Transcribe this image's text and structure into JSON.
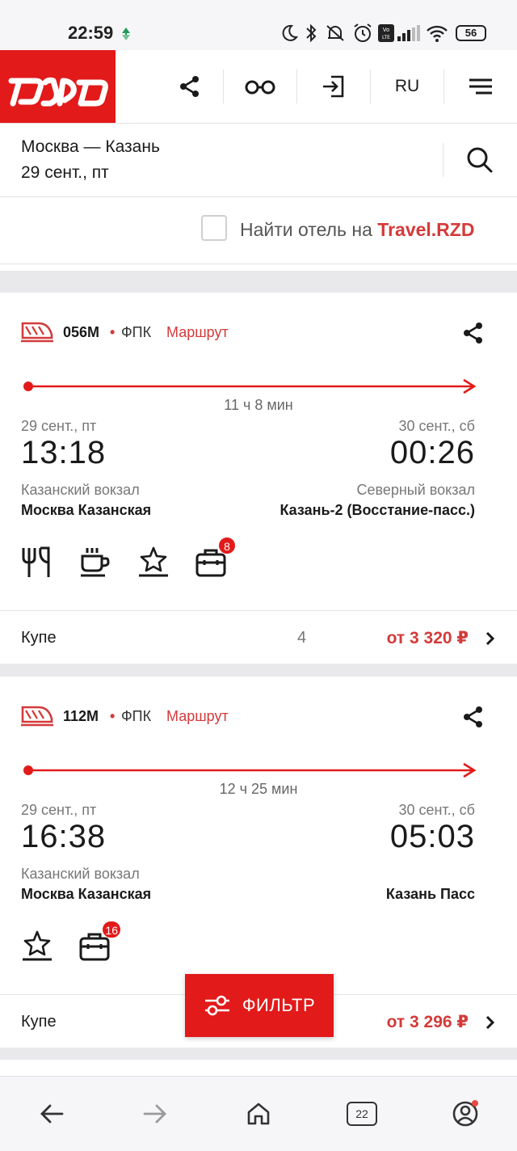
{
  "status": {
    "time": "22:59",
    "battery": "56"
  },
  "header": {
    "logo_text": "РЖД",
    "lang": "RU",
    "icons": [
      "share-icon",
      "glasses-icon",
      "login-icon",
      "menu-icon"
    ]
  },
  "search": {
    "route": "Москва — Казань",
    "date": "29 сент., пт"
  },
  "hotel": {
    "prefix": "Найти отель на ",
    "brand": "Travel.RZD"
  },
  "trains": [
    {
      "number": "056М",
      "carrier": "ФПК",
      "route_link": "Маршрут",
      "duration": "11 ч 8 мин",
      "departure": {
        "date": "29 сент., пт",
        "time": "13:18",
        "station_sub": "Казанский вокзал",
        "station": "Москва Казанская"
      },
      "arrival": {
        "date": "30 сент., сб",
        "time": "00:26",
        "station_sub": "Северный вокзал",
        "station": "Казань-2 (Восстание-пасс.)"
      },
      "amenities": [
        "restaurant-icon",
        "coffee-icon",
        "star-icon",
        "luggage-icon"
      ],
      "luggage_badge": "8",
      "fare": {
        "class": "Купе",
        "seats": "4",
        "price": "от 3 320 ₽"
      }
    },
    {
      "number": "112М",
      "carrier": "ФПК",
      "route_link": "Маршрут",
      "duration": "12 ч 25 мин",
      "departure": {
        "date": "29 сент., пт",
        "time": "16:38",
        "station_sub": "Казанский вокзал",
        "station": "Москва Казанская"
      },
      "arrival": {
        "date": "30 сент., сб",
        "time": "05:03",
        "station_sub": "",
        "station": "Казань Пасс"
      },
      "amenities": [
        "star-icon",
        "luggage-icon"
      ],
      "luggage_badge": "16",
      "fare": {
        "class": "Купе",
        "seats": "",
        "price": "от 3 296 ₽"
      }
    }
  ],
  "filter_button": "ФИЛЬТР",
  "bottom_nav": {
    "tabs_count": "22"
  },
  "colors": {
    "brand_red": "#e21a1a",
    "accent_red": "#d43a3a"
  }
}
